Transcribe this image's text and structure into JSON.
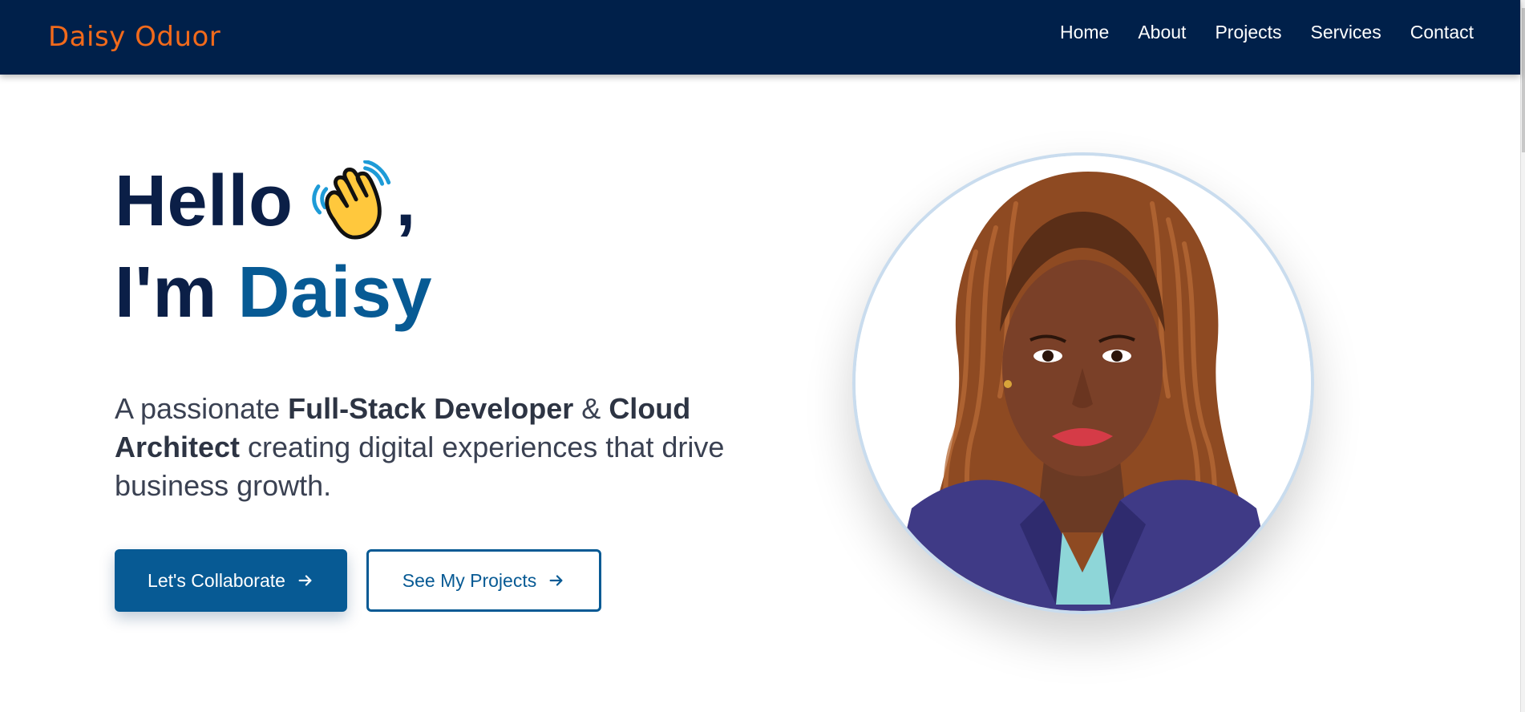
{
  "brand": {
    "name": "Daisy Oduor",
    "color": "#f26a1b"
  },
  "nav": {
    "background": "#00204a",
    "links": [
      "Home",
      "About",
      "Projects",
      "Services",
      "Contact"
    ]
  },
  "hero": {
    "greeting": "Hello",
    "greeting_emoji": "waving-hand-icon",
    "greeting_comma": ",",
    "intro_prefix": "I'm",
    "name": "Daisy",
    "accent_color": "#075a94",
    "subtitle": {
      "part1": "A passionate ",
      "bold1": "Full-Stack Developer",
      "part2": " & ",
      "bold2": "Cloud Architect",
      "part3": " creating digital experiences that drive business growth."
    },
    "primary_button": "Let's Collaborate",
    "secondary_button": "See My Projects",
    "portrait_alt": "avatar"
  }
}
